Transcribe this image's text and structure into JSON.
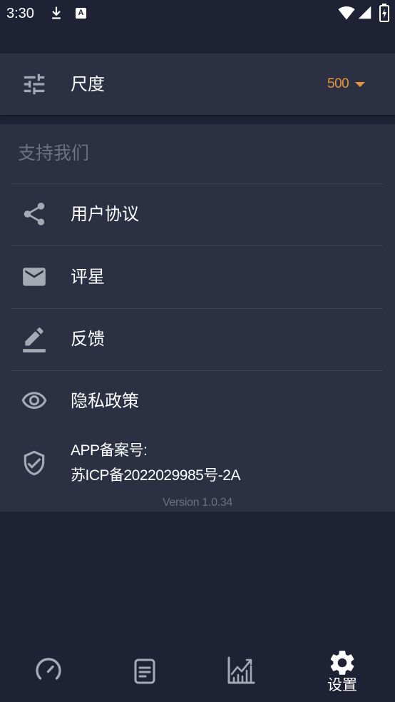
{
  "status_bar": {
    "time": "3:30",
    "notification_badge_letter": "A",
    "icons": [
      "download-icon",
      "app-notification-icon",
      "wifi-icon",
      "cellular-signal-icon",
      "battery-charging-icon"
    ]
  },
  "scale_setting": {
    "icon": "tune-icon",
    "label": "尺度",
    "value": "500",
    "dropdown_icon": "caret-down-icon"
  },
  "support_section": {
    "title": "支持我们",
    "items": [
      {
        "icon": "share-icon",
        "label": "用户协议"
      },
      {
        "icon": "mail-icon",
        "label": "评星"
      },
      {
        "icon": "edit-icon",
        "label": "反馈"
      },
      {
        "icon": "eye-icon",
        "label": "隐私政策"
      }
    ]
  },
  "filing": {
    "icon": "shield-check-icon",
    "title": "APP备案号:",
    "number": "苏ICP备2022029985号-2A"
  },
  "version": "Version 1.0.34",
  "bottom_nav": {
    "items": [
      {
        "icon": "speedometer-icon",
        "active": false
      },
      {
        "icon": "document-icon",
        "active": false
      },
      {
        "icon": "chart-icon",
        "active": false
      },
      {
        "icon": "gear-icon",
        "label": "设置",
        "active": true
      }
    ]
  },
  "colors": {
    "background": "#1f2235",
    "card": "#2b3043",
    "divider": "#3a3f52",
    "text": "#ffffff",
    "muted_text": "#6b7082",
    "icon": "#a5a9b4",
    "accent": "#e8943a"
  }
}
